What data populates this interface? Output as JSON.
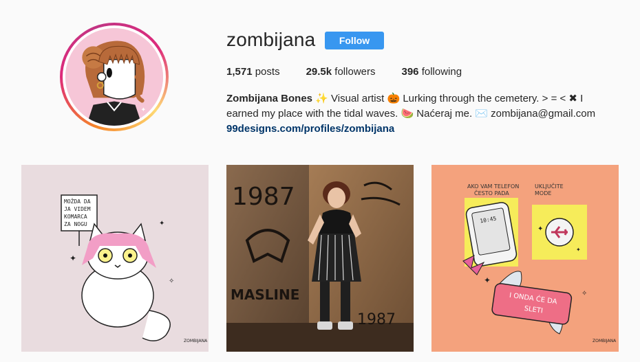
{
  "profile": {
    "username": "zombijana",
    "follow_label": "Follow",
    "posts_count": "1,571",
    "posts_label": "posts",
    "followers_count": "29.5k",
    "followers_label": "followers",
    "following_count": "396",
    "following_label": "following",
    "full_name": "Zombijana Bones",
    "bio_line1": "✨ Visual artist 🎃 Lurking through the cemetery. > = < ✖ I",
    "bio_line2": "earned my place with the tidal waves. 🍉 Naćeraj me. ✉️ zombijana@gmail.com",
    "website": "99designs.com/profiles/zombijana"
  },
  "posts": [
    {
      "kind": "illustration",
      "sign_lines": [
        "MOŽDA DA",
        "JA VIDEM",
        "KOMARCA",
        "ZA NOGU"
      ],
      "signature": "ZOMBIJANA"
    },
    {
      "kind": "photo",
      "graffiti": [
        "1987",
        "MASLINE",
        "1987"
      ]
    },
    {
      "kind": "illustration",
      "caption_left": [
        "AKO VAM TELEFON",
        "ČESTO PADA"
      ],
      "caption_right": [
        "UKLJUČITE",
        "MODE"
      ],
      "phone_time": "10:45",
      "banner": [
        "I ONDA ĆE DA",
        "SLETI"
      ],
      "signature": "ZOMBIJANA"
    }
  ],
  "colors": {
    "follow_button": "#3897f0",
    "link": "#003569",
    "text": "#262626",
    "background": "#fafafa"
  }
}
